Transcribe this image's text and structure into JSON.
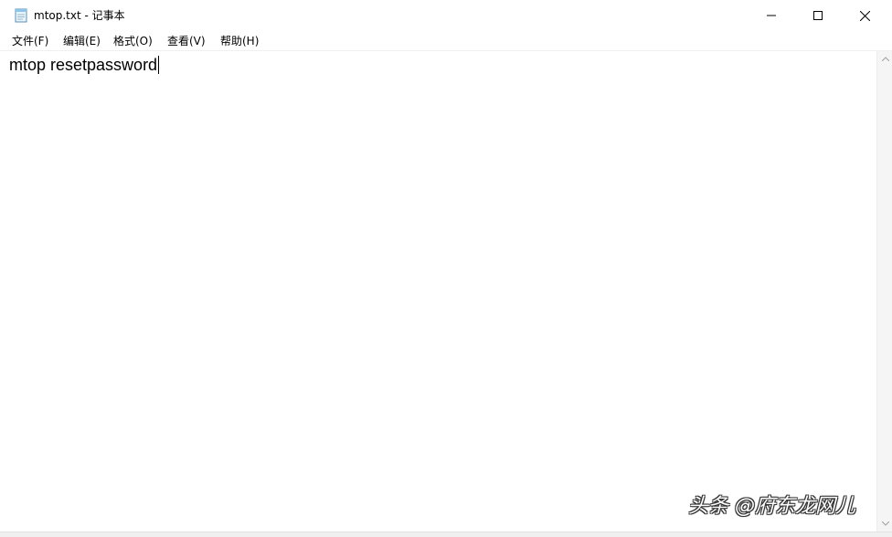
{
  "window": {
    "title": "mtop.txt - 记事本",
    "icon": "notepad-icon"
  },
  "menubar": {
    "items": [
      {
        "label": "文件(F)"
      },
      {
        "label": "编辑(E)"
      },
      {
        "label": "格式(O)"
      },
      {
        "label": "查看(V)"
      },
      {
        "label": "帮助(H)"
      }
    ]
  },
  "editor": {
    "content": "mtop resetpassword"
  },
  "watermark": {
    "text": "头条 @府东龙网儿"
  },
  "colors": {
    "background": "#ffffff",
    "scrollbar": "#f5f5f5"
  }
}
